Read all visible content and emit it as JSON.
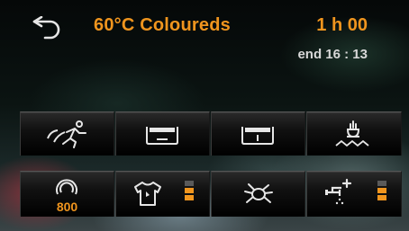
{
  "program": {
    "title": "60°C Coloureds",
    "duration": "1 h 00",
    "end_time": "end 16 : 13"
  },
  "buttons": {
    "row1": [
      {
        "id": "speed",
        "icon": "running-person-icon"
      },
      {
        "id": "water-level-low",
        "icon": "tub-low-water-icon"
      },
      {
        "id": "water-level-high",
        "icon": "tub-high-water-icon"
      },
      {
        "id": "soak",
        "icon": "hand-in-water-icon"
      }
    ],
    "row2": [
      {
        "id": "spin",
        "icon": "spin-drum-icon",
        "value": "800"
      },
      {
        "id": "stain",
        "icon": "shirt-stain-icon",
        "level_filled": 2,
        "level_total": 3
      },
      {
        "id": "allergy",
        "icon": "mite-icon"
      },
      {
        "id": "rinse",
        "icon": "tap-plus-icon",
        "level_filled": 2,
        "level_total": 3
      }
    ]
  },
  "colors": {
    "accent": "#f0951e",
    "icon": "#e6e6e6",
    "level_empty": "#5a5a5a"
  }
}
